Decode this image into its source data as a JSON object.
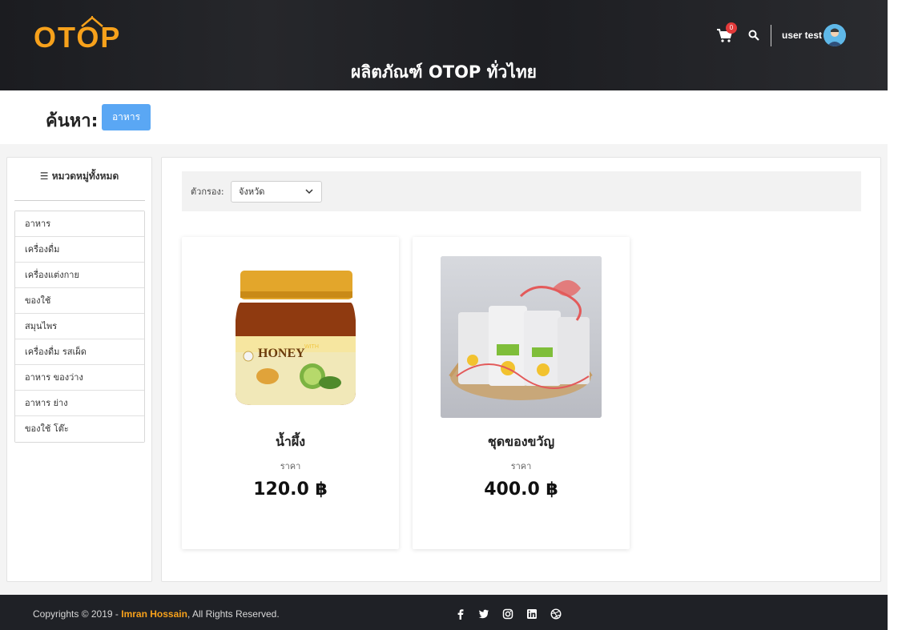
{
  "header": {
    "logo_text": "OTOP",
    "site_title": "ผลิตภัณฑ์ OTOP ทั่วไทย",
    "cart_count": "0",
    "user_name": "user test",
    "brand_color": "#f7a11b"
  },
  "search": {
    "label": "ค้นหา:",
    "tag": "อาหาร",
    "tag_color": "#5aa7f4"
  },
  "sidebar": {
    "header": "หมวดหมู่ทั้งหมด",
    "header_icon": "list-icon",
    "items": [
      {
        "label": "อาหาร"
      },
      {
        "label": "เครื่องดื่ม"
      },
      {
        "label": "เครื่องแต่งกาย"
      },
      {
        "label": "ของใช้"
      },
      {
        "label": "สมุนไพร"
      },
      {
        "label": "เครื่องดื่ม รสเผ็ด"
      },
      {
        "label": "อาหาร ของว่าง"
      },
      {
        "label": "อาหาร ย่าง"
      },
      {
        "label": "ของใช้ โต๊ะ"
      }
    ]
  },
  "filter": {
    "label": "ตัวกรอง:",
    "selected": "จังหวัด"
  },
  "products": [
    {
      "name": "น้ำผึ้ง",
      "price_label": "ราคา",
      "price": "120.0 ฿",
      "image": "honey-jar-image"
    },
    {
      "name": "ชุดของขวัญ",
      "price_label": "ราคา",
      "price": "400.0 ฿",
      "image": "gift-basket-image"
    }
  ],
  "footer": {
    "copyright_prefix": "Copyrights © 2019 - ",
    "author": "Imran Hossain",
    "copyright_suffix": ", All Rights Reserved.",
    "social_icons": [
      "facebook-icon",
      "twitter-icon",
      "instagram-icon",
      "linkedin-icon",
      "dribbble-icon"
    ]
  }
}
